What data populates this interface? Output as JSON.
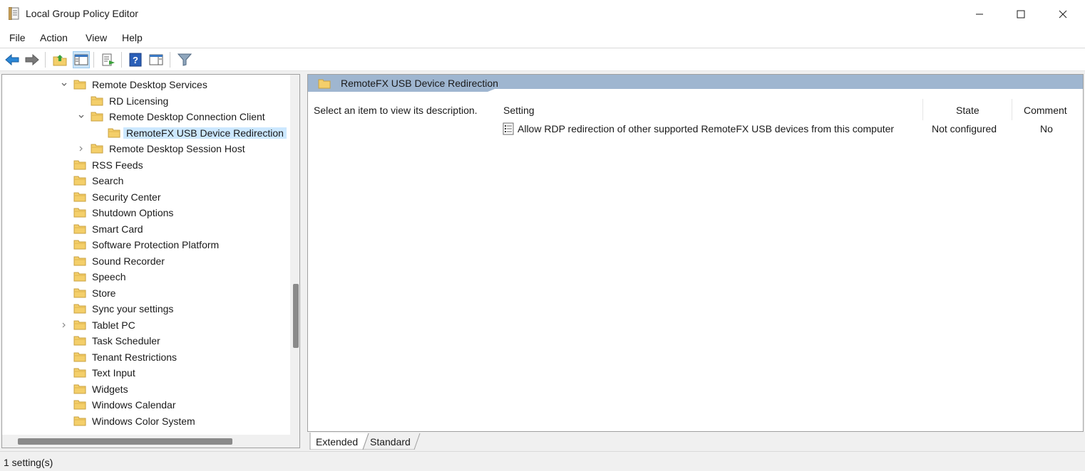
{
  "window": {
    "title": "Local Group Policy Editor",
    "icon": "policy-editor-icon"
  },
  "menu": {
    "items": [
      "File",
      "Action",
      "View",
      "Help"
    ]
  },
  "toolbar": {
    "buttons": [
      "back-icon",
      "forward-icon",
      "up-folder-icon",
      "show-hide-tree-icon",
      "export-list-icon",
      "help-icon",
      "show-action-pane-icon",
      "filter-icon"
    ]
  },
  "tree": {
    "items": [
      {
        "label": "Remote Desktop Services",
        "expander": "expanded"
      },
      {
        "label": "RD Licensing",
        "expander": "none"
      },
      {
        "label": "Remote Desktop Connection Client",
        "expander": "expanded"
      },
      {
        "label": "RemoteFX USB Device Redirection",
        "expander": "none",
        "selected": true
      },
      {
        "label": "Remote Desktop Session Host",
        "expander": "collapsed"
      },
      {
        "label": "RSS Feeds",
        "expander": "none"
      },
      {
        "label": "Search",
        "expander": "none"
      },
      {
        "label": "Security Center",
        "expander": "none"
      },
      {
        "label": "Shutdown Options",
        "expander": "none"
      },
      {
        "label": "Smart Card",
        "expander": "none"
      },
      {
        "label": "Software Protection Platform",
        "expander": "none"
      },
      {
        "label": "Sound Recorder",
        "expander": "none"
      },
      {
        "label": "Speech",
        "expander": "none"
      },
      {
        "label": "Store",
        "expander": "none"
      },
      {
        "label": "Sync your settings",
        "expander": "none"
      },
      {
        "label": "Tablet PC",
        "expander": "collapsed"
      },
      {
        "label": "Task Scheduler",
        "expander": "none"
      },
      {
        "label": "Tenant Restrictions",
        "expander": "none"
      },
      {
        "label": "Text Input",
        "expander": "none"
      },
      {
        "label": "Widgets",
        "expander": "none"
      },
      {
        "label": "Windows Calendar",
        "expander": "none"
      },
      {
        "label": "Windows Color System",
        "expander": "none"
      }
    ]
  },
  "details": {
    "header_title": "RemoteFX USB Device Redirection",
    "description": "Select an item to view its description.",
    "columns": {
      "setting": "Setting",
      "state": "State",
      "comment": "Comment"
    },
    "rows": [
      {
        "setting": "Allow RDP redirection of other supported RemoteFX USB devices from this computer",
        "state": "Not configured",
        "comment": "No"
      }
    ]
  },
  "tabs": {
    "extended": "Extended",
    "standard": "Standard"
  },
  "status": {
    "text": "1 setting(s)"
  },
  "colors": {
    "header_band": "#9fb6d0",
    "selection": "#cce8ff",
    "folder": "#f4cf6a"
  }
}
